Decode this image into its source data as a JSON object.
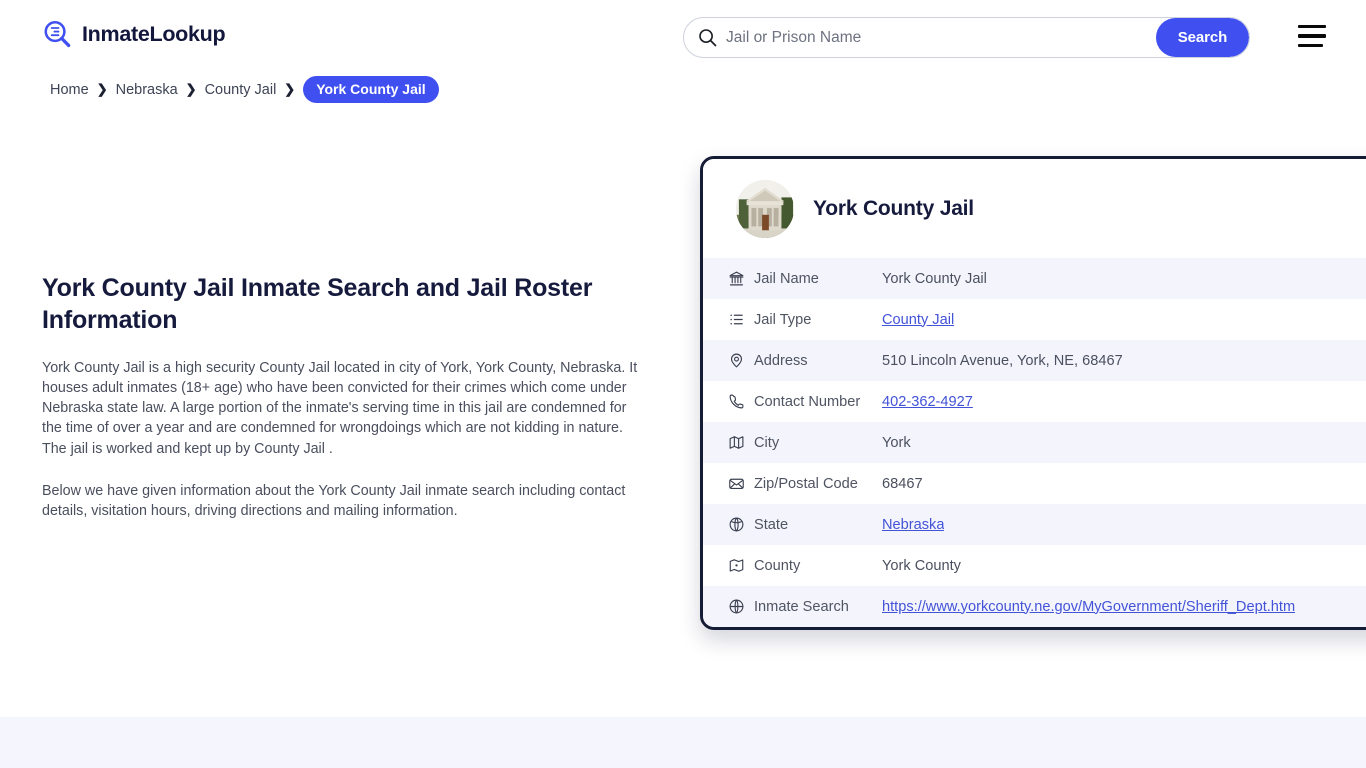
{
  "header": {
    "brand_name": "InmateLookup",
    "brand_icon": "magnifier-logo-icon",
    "search": {
      "placeholder": "Jail or Prison Name",
      "value": "",
      "icon": "search-icon",
      "button_label": "Search"
    },
    "menu_icon": "hamburger-menu-icon"
  },
  "breadcrumb": {
    "items": [
      {
        "label": "Home",
        "current": false
      },
      {
        "label": "Nebraska",
        "current": false
      },
      {
        "label": "County Jail",
        "current": false
      },
      {
        "label": "York County Jail",
        "current": true
      }
    ],
    "separator": "❯"
  },
  "main": {
    "page_title": "York County Jail Inmate Search and Jail Roster Information",
    "paragraphs": [
      "York County Jail is a high security County Jail located in city of York, York County, Nebraska. It houses adult inmates (18+ age) who have been convicted for their crimes which come under Nebraska state law. A large portion of the inmate's serving time in this jail are condemned for the time of over a year and are condemned for wrongdoings which are not kidding in nature. The jail is worked and kept up by County Jail .",
      "Below we have given information about the York County Jail inmate search including contact details, visitation hours, driving directions and mailing information."
    ]
  },
  "info_card": {
    "avatar_icon": "courthouse-photo",
    "title": "York County Jail",
    "rows": [
      {
        "icon": "bank-icon",
        "label": "Jail Name",
        "value": "York County Jail",
        "link": false
      },
      {
        "icon": "list-icon",
        "label": "Jail Type",
        "value": "County Jail",
        "link": true
      },
      {
        "icon": "map-pin-icon",
        "label": "Address",
        "value": "510 Lincoln Avenue, York, NE, 68467",
        "link": false
      },
      {
        "icon": "phone-icon",
        "label": "Contact Number",
        "value": "402-362-4927",
        "link": true
      },
      {
        "icon": "map-icon",
        "label": "City",
        "value": "York",
        "link": false
      },
      {
        "icon": "envelope-icon",
        "label": "Zip/Postal Code",
        "value": "68467",
        "link": false
      },
      {
        "icon": "globe-pin-icon",
        "label": "State",
        "value": "Nebraska",
        "link": true
      },
      {
        "icon": "county-icon",
        "label": "County",
        "value": "York County",
        "link": false
      },
      {
        "icon": "globe-icon",
        "label": "Inmate Search",
        "value": "https://www.yorkcounty.ne.gov/MyGovernment/Sheriff_Dept.htm",
        "link": true
      }
    ]
  },
  "colors": {
    "accent": "#4050f0",
    "card_border": "#151c36",
    "link": "#4353d8",
    "row_alt_bg": "#f4f5fc",
    "bottom_band_bg": "#f5f5fd",
    "title": "#161b3d"
  }
}
